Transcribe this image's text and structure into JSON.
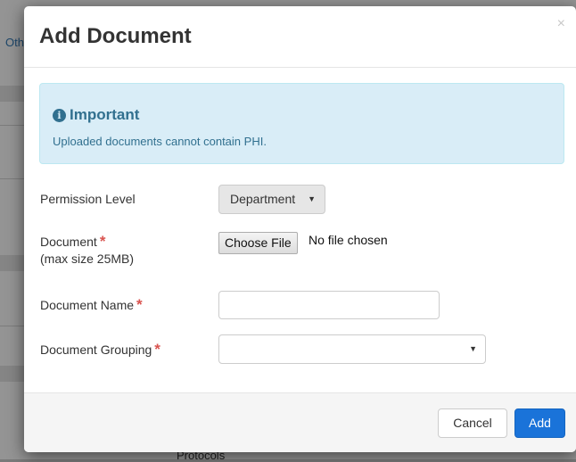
{
  "background": {
    "partial_tab_text": "Oth",
    "partial_bottom_text": "Protocols"
  },
  "modal": {
    "title": "Add Document",
    "close_glyph": "×",
    "alert": {
      "icon": "info-icon",
      "title": "Important",
      "message": "Uploaded documents cannot contain PHI.",
      "color": "#31708f",
      "background": "#d9edf7"
    },
    "form": {
      "permission_level": {
        "label": "Permission Level",
        "value": "Department"
      },
      "document": {
        "label": "Document",
        "sublabel": "(max size 25MB)",
        "required_mark": "*",
        "button_label": "Choose File",
        "status": "No file chosen"
      },
      "document_name": {
        "label": "Document Name",
        "required_mark": "*",
        "value": ""
      },
      "document_grouping": {
        "label": "Document Grouping",
        "required_mark": "*",
        "value": ""
      }
    },
    "footer": {
      "cancel_label": "Cancel",
      "add_label": "Add",
      "primary_color": "#1a73d9"
    }
  }
}
